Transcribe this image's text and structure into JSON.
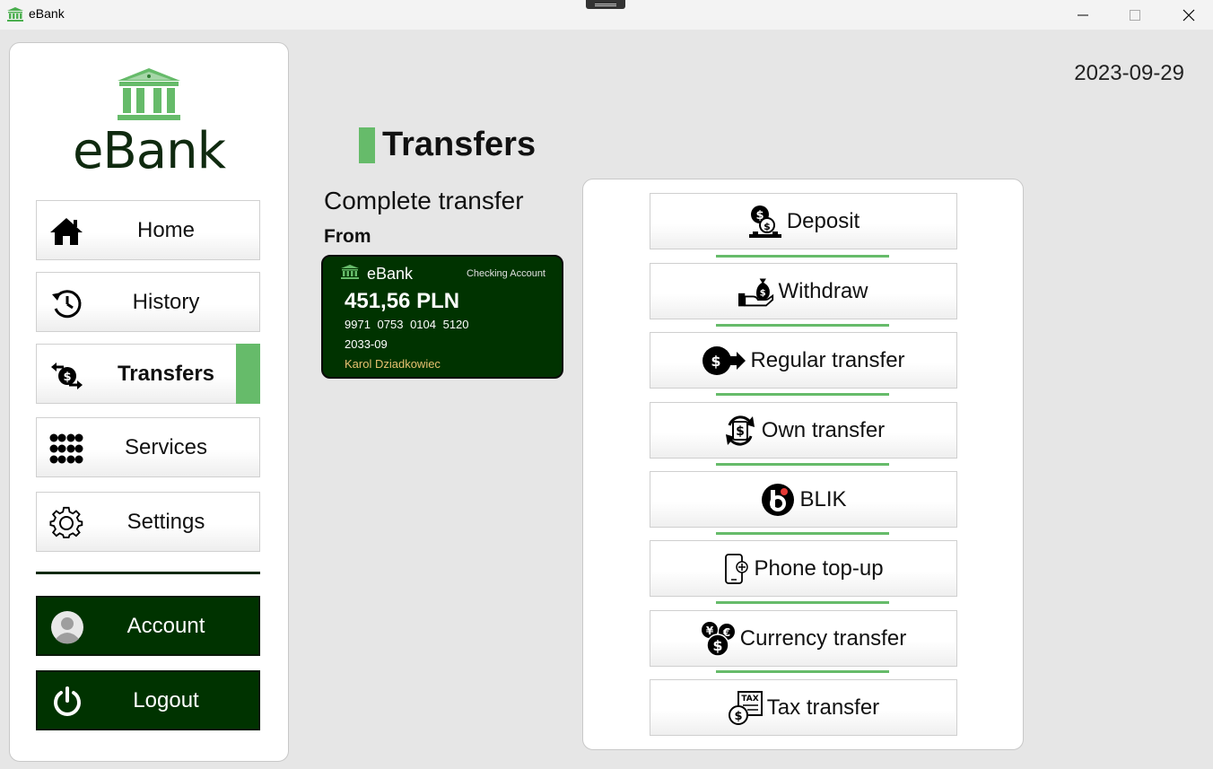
{
  "window": {
    "title": "eBank",
    "controls": [
      "minimize-icon",
      "maximize-icon",
      "close-icon"
    ]
  },
  "sidebar": {
    "logo_text": "eBank",
    "nav": [
      {
        "label": "Home",
        "icon": "home-icon"
      },
      {
        "label": "History",
        "icon": "history-icon"
      },
      {
        "label": "Transfers",
        "icon": "transfer-icon",
        "active": true
      },
      {
        "label": "Services",
        "icon": "grid-icon"
      },
      {
        "label": "Settings",
        "icon": "gear-icon"
      }
    ],
    "account_label": "Account",
    "logout_label": "Logout"
  },
  "header": {
    "date": "2023-09-29",
    "page_title": "Transfers"
  },
  "main": {
    "subtitle": "Complete transfer",
    "from_label": "From",
    "card": {
      "brand": "eBank",
      "type": "Checking Account",
      "balance": "451,56 PLN",
      "number": "9971 0753 0104 5120",
      "expiry": "2033-09",
      "holder": "Karol Dziadkowiec"
    },
    "options": [
      {
        "label": "Deposit",
        "icon": "deposit-icon"
      },
      {
        "label": "Withdraw",
        "icon": "withdraw-icon"
      },
      {
        "label": "Regular transfer",
        "icon": "regular-transfer-icon"
      },
      {
        "label": "Own transfer",
        "icon": "own-transfer-icon"
      },
      {
        "label": "BLIK",
        "icon": "blik-icon"
      },
      {
        "label": "Phone top-up",
        "icon": "phone-topup-icon"
      },
      {
        "label": "Currency transfer",
        "icon": "currency-icon"
      },
      {
        "label": "Tax transfer",
        "icon": "tax-icon"
      }
    ]
  },
  "colors": {
    "accent_green": "#66bb6a",
    "dark_green": "#003300",
    "holder_gold": "#e8c070"
  }
}
